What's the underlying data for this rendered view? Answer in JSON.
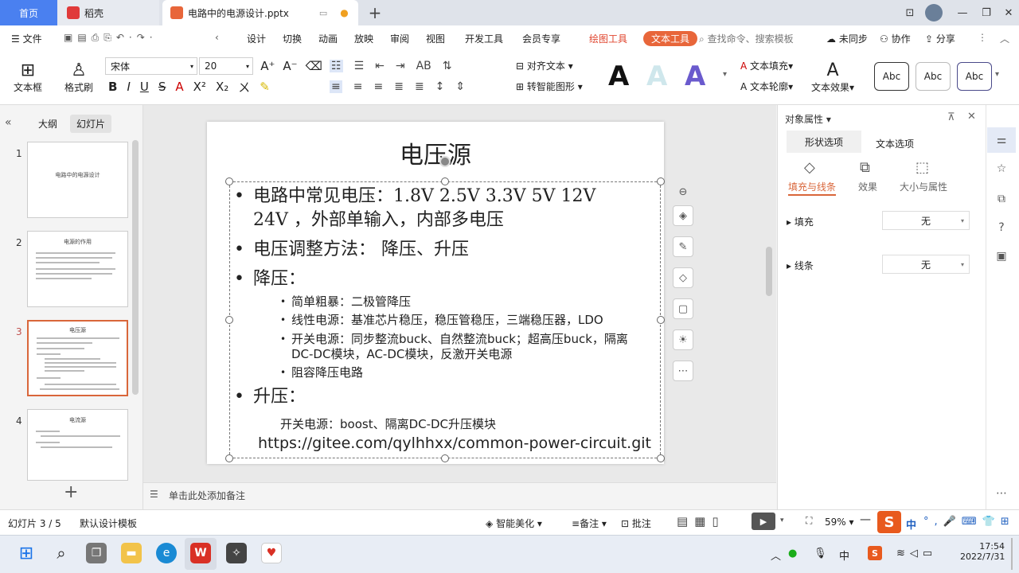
{
  "tabs": {
    "home": "首页",
    "daoke": "稻壳",
    "file": "电路中的电源设计.pptx"
  },
  "menu": {
    "file": "文件",
    "items": [
      "设计",
      "切换",
      "动画",
      "放映",
      "审阅",
      "视图",
      "开发工具",
      "会员专享"
    ],
    "drawing_tools": "绘图工具",
    "text_tools": "文本工具",
    "search_placeholder": "查找命令、搜索模板",
    "unsynced": "未同步",
    "collab": "协作",
    "share": "分享"
  },
  "ribbon": {
    "textbox": "文本框",
    "format_brush": "格式刷",
    "font_name": "宋体",
    "font_size": "20",
    "align_text": "对齐文本",
    "smart_shape": "转智能图形",
    "text_fill": "文本填充",
    "text_outline": "文本轮廓",
    "text_effect": "文本效果",
    "style_samples": [
      "Abc",
      "Abc",
      "Abc"
    ],
    "big_a": "A"
  },
  "left_panel": {
    "outline_tab": "大纲",
    "slides_tab": "幻灯片",
    "thumbnails": [
      {
        "num": "1",
        "title": "电路中的电源设计"
      },
      {
        "num": "2",
        "title": "电源的作用"
      },
      {
        "num": "3",
        "title": "电压源"
      },
      {
        "num": "4",
        "title": "电流源"
      }
    ]
  },
  "slide": {
    "title": "电压源",
    "b1_line1": "电路中常见电压：1.8V 2.5V 3.3V 5V 12V",
    "b1_line2": "24V ，外部单输入，内部多电压",
    "b2": "电压调整方法： 降压、升压",
    "b3": "降压：",
    "sub1": "简单粗暴：二极管降压",
    "sub2": "线性电源：基准芯片稳压，稳压管稳压，三端稳压器，LDO",
    "sub3_line1": "开关电源：同步整流buck、自然整流buck；超高压buck，隔离",
    "sub3_line2": "DC-DC模块，AC-DC模块，反激开关电源",
    "sub4": "阻容降压电路",
    "b4": "升压：",
    "boost": "开关电源：boost、隔离DC-DC升压模块",
    "url": "https://gitee.com/qylhhxx/common-power-circuit.git"
  },
  "notes_placeholder": "单击此处添加备注",
  "right_panel": {
    "title": "对象属性",
    "tab_shape": "形状选项",
    "tab_text": "文本选项",
    "sub_fill_line": "填充与线条",
    "sub_effect": "效果",
    "sub_size": "大小与属性",
    "fill_label": "填充",
    "fill_value": "无",
    "line_label": "线条",
    "line_value": "无"
  },
  "status": {
    "slide_pos": "幻灯片 3 / 5",
    "template": "默认设计模板",
    "smart_beautify": "智能美化",
    "notes": "备注",
    "comment": "批注",
    "zoom": "59%",
    "ime": "中"
  },
  "taskbar": {
    "ime": "中",
    "time": "17:54",
    "date": "2022/7/31"
  },
  "colors": {
    "accent_blue": "#4a80f0",
    "drawing_tools_red": "#e0452e",
    "slide_selection": "#c0504d"
  }
}
